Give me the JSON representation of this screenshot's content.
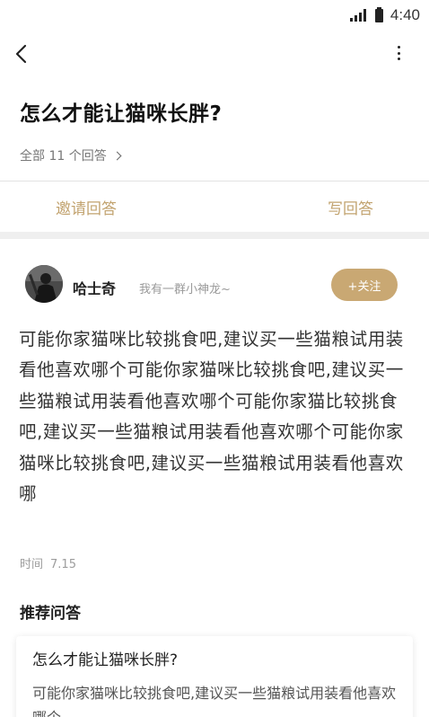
{
  "status_bar": {
    "time": "4:40",
    "icons": [
      "signal-icon",
      "battery-icon"
    ]
  },
  "nav": {
    "back_icon": "back-arrow-icon",
    "more_icon": "more-vertical-icon"
  },
  "question": {
    "title": "怎么才能让猫咪长胖?",
    "answer_count_label": "全部 11 个回答"
  },
  "actions": {
    "invite_label": "邀请回答",
    "write_label": "写回答"
  },
  "answer": {
    "author_name": "哈士奇",
    "author_signature": "我有一群小神龙~",
    "follow_label": "+关注",
    "body": "可能你家猫咪比较挑食吧,建议买一些猫粮试用装看他喜欢哪个可能你家猫咪比较挑食吧,建议买一些猫粮试用装看他喜欢哪个可能你家猫比较挑食吧,建议买一些猫粮试用装看他喜欢哪个可能你家猫咪比较挑食吧,建议买一些猫粮试用装看他喜欢哪",
    "time_label": "时间",
    "time_value": "7.15"
  },
  "recommended": {
    "heading": "推荐问答",
    "items": [
      {
        "title": "怎么才能让猫咪长胖?",
        "snippet": "可能你家猫咪比较挑食吧,建议买一些猫粮试用装看他喜欢哪个"
      }
    ]
  },
  "colors": {
    "accent": "#c2a36f",
    "follow_bg": "#c9a873",
    "section_gap": "#efefef"
  }
}
